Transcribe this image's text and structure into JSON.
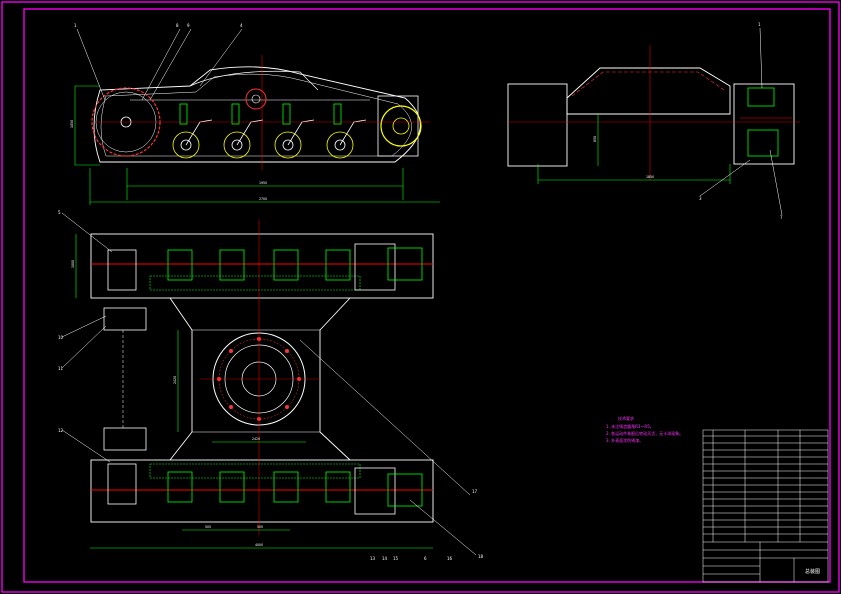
{
  "colors": {
    "background": "#000000",
    "frame": "#ff00ff",
    "outline": "#ffffff",
    "centerline": "#ff0000",
    "hatch": "#00ff00",
    "accent_yellow": "#ffff00",
    "accent_cyan": "#00ffff"
  },
  "callouts": {
    "top_left": [
      "1",
      "8",
      "9",
      "4"
    ],
    "top_right": [
      "1",
      "3",
      "7"
    ],
    "plan_left": [
      "5",
      "10",
      "11",
      "12"
    ],
    "plan_bottom": [
      "13",
      "14",
      "15",
      "6",
      "16"
    ],
    "plan_right": [
      "17",
      "18"
    ]
  },
  "dimensions": {
    "side_height": "1050",
    "side_inner": "1950",
    "side_overall": "2700",
    "end_height": "850",
    "end_width": "1850",
    "plan_track": "1000",
    "plan_gauge": "2420",
    "plan_center": "2420",
    "plan_pitch_a": "505",
    "plan_pitch_b": "505",
    "plan_overall": "4000"
  },
  "notes": {
    "heading": "技术要求",
    "lines": [
      "1. 未注铸造圆角R3～R5。",
      "2. 各运动件装配后转动灵活，无卡滞现象。",
      "3. 外表面涂防锈漆。"
    ]
  },
  "title_block": {
    "drawing_name": "总装图"
  }
}
